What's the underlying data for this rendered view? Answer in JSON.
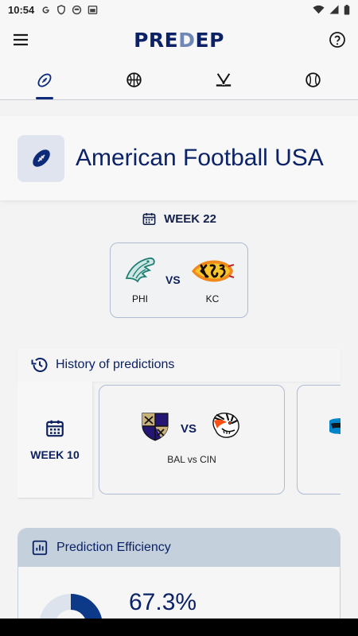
{
  "status_bar": {
    "time": "10:54",
    "left_icons": [
      "google-icon",
      "shield-icon",
      "face-icon",
      "calendar-icon"
    ],
    "right_icons": [
      "wifi-icon",
      "signal-icon",
      "battery-icon"
    ]
  },
  "header": {
    "logo_pre": "PRE",
    "logo_d": "D",
    "logo_ep": "EP"
  },
  "sport_tabs": [
    {
      "icon": "american-football-icon",
      "active": true
    },
    {
      "icon": "basketball-icon",
      "active": false
    },
    {
      "icon": "hockey-icon",
      "active": false
    },
    {
      "icon": "baseball-icon",
      "active": false
    }
  ],
  "sport": {
    "title": "American Football USA",
    "icon": "american-football-icon"
  },
  "current": {
    "week_label": "WEEK 22",
    "home_team": "PHI",
    "away_team": "KC",
    "vs": "VS"
  },
  "history": {
    "title": "History of predictions",
    "week_label": "WEEK 10",
    "vs": "VS",
    "match_label": "BAL vs CIN"
  },
  "efficiency": {
    "title": "Prediction Efficiency",
    "value": "67.3%",
    "fraction": 0.673
  },
  "colors": {
    "primary": "#0b2266",
    "accent": "#6d87b6",
    "background": "#f3f3f4"
  }
}
